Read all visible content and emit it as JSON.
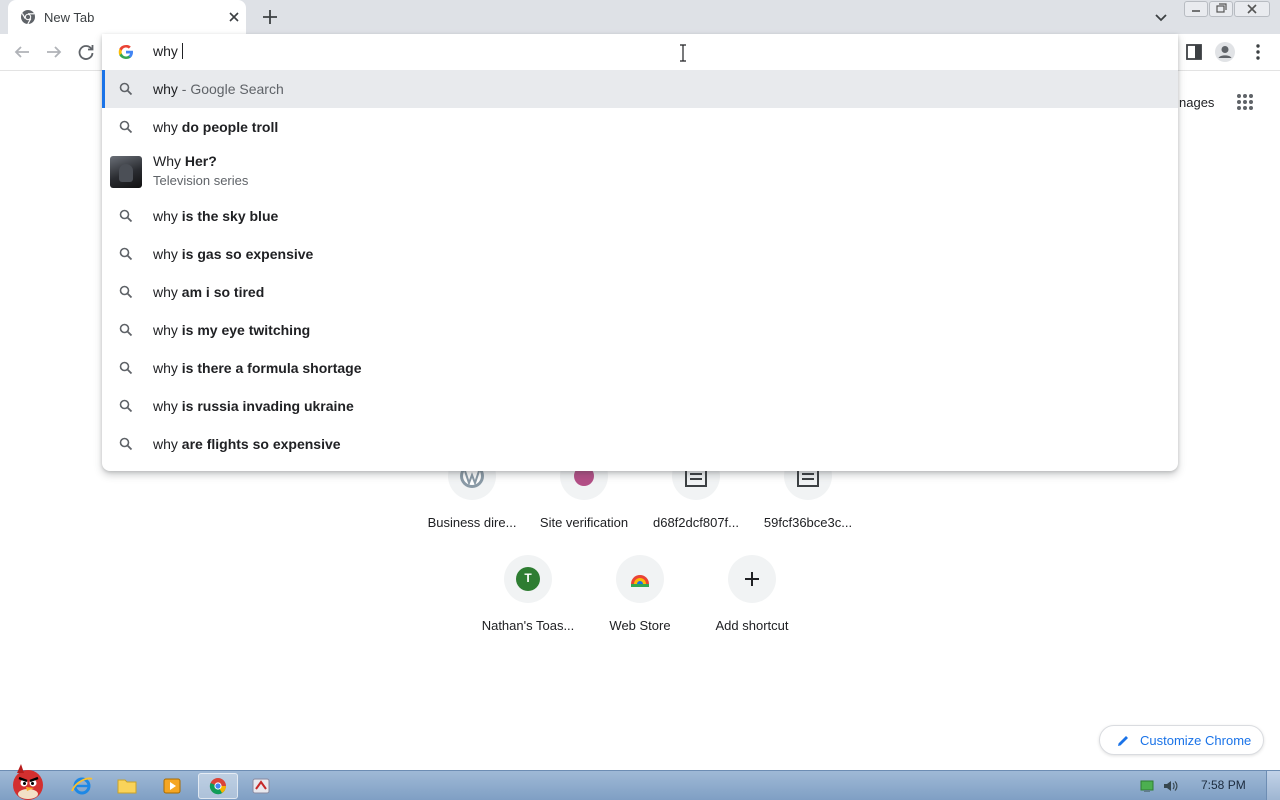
{
  "tab": {
    "title": "New Tab"
  },
  "omnibox": {
    "query": "why",
    "suggestions": [
      {
        "typed": "why",
        "completion": "",
        "suffix": " - Google Search",
        "selected": true
      },
      {
        "typed": "why",
        "completion": " do people troll"
      },
      {
        "entity": true,
        "typed": "Why",
        "completion": " Her?",
        "subtitle": "Television series"
      },
      {
        "typed": "why",
        "completion": " is the sky blue"
      },
      {
        "typed": "why",
        "completion": " is gas so expensive"
      },
      {
        "typed": "why",
        "completion": " am i so tired"
      },
      {
        "typed": "why",
        "completion": " is my eye twitching"
      },
      {
        "typed": "why",
        "completion": " is there a formula shortage"
      },
      {
        "typed": "why",
        "completion": " is russia invading ukraine"
      },
      {
        "typed": "why",
        "completion": " are flights so expensive"
      }
    ]
  },
  "ntp": {
    "images_link": "nages",
    "shortcuts_row1": [
      {
        "label": "Business dire..."
      },
      {
        "label": "Site verification"
      },
      {
        "label": "d68f2dcf807f..."
      },
      {
        "label": "59fcf36bce3c..."
      }
    ],
    "shortcuts_row2": [
      {
        "label": "Nathan's Toas...",
        "letter": "T"
      },
      {
        "label": "Web Store"
      },
      {
        "label": "Add shortcut"
      }
    ],
    "customize_label": "Customize Chrome"
  },
  "taskbar": {
    "clock": "7:58 PM"
  },
  "colors": {
    "accent": "#1a73e8",
    "tab_strip": "#dee1e6",
    "selected_row": "#e8eaed"
  }
}
